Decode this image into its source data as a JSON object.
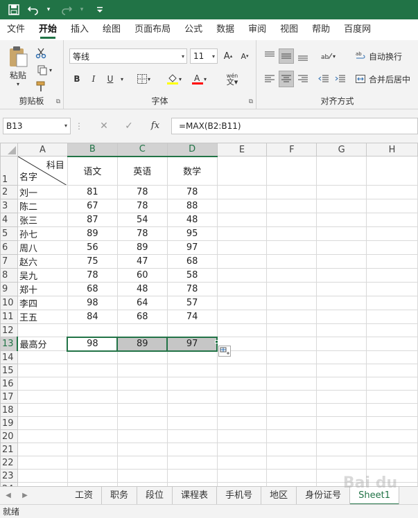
{
  "quick_access": {
    "save_icon": "save-icon",
    "undo_icon": "undo-icon",
    "redo_icon": "redo-icon",
    "customize_icon": "customize-icon"
  },
  "tabs": [
    "文件",
    "开始",
    "插入",
    "绘图",
    "页面布局",
    "公式",
    "数据",
    "审阅",
    "视图",
    "帮助",
    "百度网"
  ],
  "ribbon": {
    "clipboard": {
      "paste_label": "粘贴",
      "group_label": "剪贴板"
    },
    "font": {
      "font_name": "等线",
      "font_size": "11",
      "bold": "B",
      "italic": "I",
      "underline": "U",
      "group_label": "字体",
      "phonetic": "wén"
    },
    "alignment": {
      "wrap_text": "自动换行",
      "merge_center": "合并后居中",
      "group_label": "对齐方式"
    }
  },
  "formula_bar": {
    "name_box": "B13",
    "formula": "=MAX(B2:B11)",
    "fx": "fx"
  },
  "columns": [
    "A",
    "B",
    "C",
    "D",
    "E",
    "F",
    "G",
    "H"
  ],
  "header_cell": {
    "top": "科目",
    "bottom": "名字"
  },
  "subjects": [
    "语文",
    "英语",
    "数学"
  ],
  "rows": [
    {
      "name": "刘一",
      "scores": [
        81,
        78,
        78
      ]
    },
    {
      "name": "陈二",
      "scores": [
        67,
        78,
        88
      ]
    },
    {
      "name": "张三",
      "scores": [
        87,
        54,
        48
      ]
    },
    {
      "name": "孙七",
      "scores": [
        89,
        78,
        95
      ]
    },
    {
      "name": "周八",
      "scores": [
        56,
        89,
        97
      ]
    },
    {
      "name": "赵六",
      "scores": [
        75,
        47,
        68
      ]
    },
    {
      "name": "吴九",
      "scores": [
        78,
        60,
        58
      ]
    },
    {
      "name": "郑十",
      "scores": [
        68,
        48,
        78
      ]
    },
    {
      "name": "李四",
      "scores": [
        98,
        64,
        57
      ]
    },
    {
      "name": "王五",
      "scores": [
        84,
        68,
        74
      ]
    }
  ],
  "max_row": {
    "label": "最高分",
    "values": [
      98,
      89,
      97
    ]
  },
  "sheet_tabs": [
    "工资",
    "职务",
    "段位",
    "课程表",
    "手机号",
    "地区",
    "身份证号",
    "Sheet1"
  ],
  "active_sheet": "Sheet1",
  "status": "就绪",
  "watermark": "Bai du"
}
